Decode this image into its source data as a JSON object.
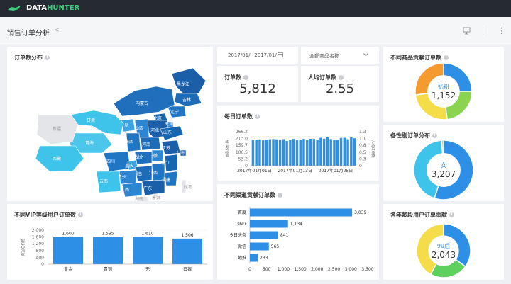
{
  "app": {
    "logo_prefix": "DATA",
    "logo_suffix": "HUNTER"
  },
  "page": {
    "title": "销售订单分析"
  },
  "filters": {
    "date_range": "2017/01/~2017/01/",
    "product": "全部商品名称"
  },
  "kpis": {
    "orders_title": "订单数",
    "orders_value": "5,812",
    "avg_title": "人均订单数",
    "avg_value": "2.55"
  },
  "map_card": {
    "title": "订单数分布",
    "provinces": [
      "黑龙江",
      "吉林",
      "辽宁",
      "内蒙古",
      "北京",
      "河北",
      "天津",
      "山西",
      "宁夏",
      "甘肃",
      "青海",
      "西藏",
      "新疆",
      "陕西",
      "河南",
      "山东",
      "江苏",
      "安徽",
      "湖北",
      "四川",
      "重庆",
      "湖南",
      "江西",
      "浙江",
      "上海",
      "贵州",
      "云南",
      "广西",
      "广东",
      "福建",
      "台湾",
      "海南",
      "香港"
    ]
  },
  "vip_card": {
    "title": "不同VIP等级用户订单数",
    "ylabel": "商品总价格",
    "yticks": [
      "2,000",
      "1,600",
      "1,200",
      "800",
      "400",
      "0"
    ],
    "chart_data": {
      "type": "bar",
      "categories": [
        "黄金",
        "青铜",
        "无",
        "白银"
      ],
      "values": [
        1600,
        1595,
        1610,
        1506
      ],
      "ylim": [
        0,
        2000
      ]
    }
  },
  "daily_card": {
    "title": "每日订单数",
    "ylabel_left": "商品总价格",
    "ylabel_right": "人均订单数",
    "yticks_left": [
      "266.2",
      "213.0",
      "159.7",
      "106.5",
      "53.2",
      "0"
    ],
    "yticks_right": [
      "1.3",
      "1.1",
      "0.8",
      "0.5",
      "0.3",
      "0"
    ],
    "xticks": [
      "2017年01月01日",
      "2017年01月13日",
      "2017年01月25日"
    ],
    "chart_data": {
      "type": "bar+line",
      "bars": [
        200,
        203,
        206,
        199,
        205,
        207,
        209,
        207,
        204,
        208,
        194,
        201,
        210,
        199,
        202,
        210,
        203,
        211,
        210,
        205,
        219,
        212,
        225,
        209,
        203,
        202,
        218,
        219,
        208,
        226,
        215
      ],
      "line": [
        1.1,
        1.1,
        1.1,
        1.1,
        1.1,
        1.1,
        1.1,
        1.1,
        1.1,
        1.1,
        1.1,
        1.1,
        1.1,
        1.1,
        1.1,
        1.1,
        1.1,
        1.1,
        1.1,
        1.1,
        1.1,
        1.1,
        1.1,
        1.1,
        1.1,
        1.1,
        1.1,
        1.1,
        1.1,
        1.1,
        1.1
      ],
      "ylim_left": [
        0,
        266.2
      ],
      "ylim_right": [
        0,
        1.3
      ]
    }
  },
  "channel_card": {
    "title": "不同渠道贡献订单数",
    "xticks": [
      "0",
      "500",
      "1,000",
      "1,500",
      "2,000",
      "2,500",
      "3,000",
      "3,500"
    ],
    "chart_data": {
      "type": "hbar",
      "categories": [
        "百度",
        "36kr",
        "今日头条",
        "微信",
        "地推"
      ],
      "values": [
        3039,
        1134,
        841,
        565,
        233
      ],
      "xlim": [
        0,
        3500
      ]
    }
  },
  "product_card": {
    "title": "不同商品贡献订单数",
    "center_label": "奶粉",
    "center_value": "1,152",
    "chart_data": {
      "type": "pie",
      "values": [
        0.25,
        0.23,
        0.25,
        0.27
      ],
      "colors": [
        "#2e8fe6",
        "#8bd450",
        "#f5dd4a",
        "#f59a2e"
      ]
    }
  },
  "gender_card": {
    "title": "各性别订单分布",
    "center_label": "女",
    "center_value": "3,207",
    "chart_data": {
      "type": "pie",
      "values": [
        0.55,
        0.44,
        0.01
      ],
      "colors": [
        "#2e8fe6",
        "#3ec3ea",
        "#8bd450"
      ]
    }
  },
  "age_card": {
    "title": "各年龄段用户订单贡献",
    "center_label": "90后",
    "center_value": "2,043",
    "chart_data": {
      "type": "pie",
      "values": [
        0.35,
        0.23,
        0.42
      ],
      "colors": [
        "#2e8fe6",
        "#5ed05e",
        "#f5dd4a"
      ]
    }
  }
}
